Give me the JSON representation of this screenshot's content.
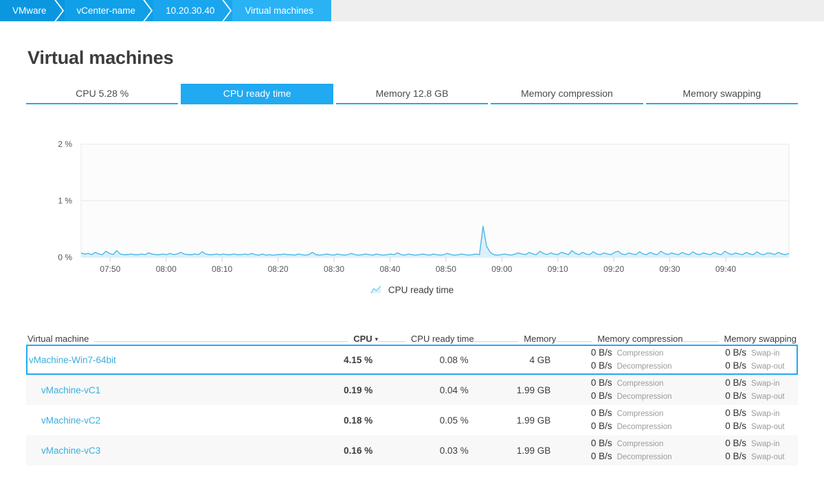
{
  "breadcrumb": {
    "items": [
      {
        "label": "VMware",
        "color": "#0a97e0"
      },
      {
        "label": "vCenter-name",
        "color": "#0fa0e8"
      },
      {
        "label": "10.20.30.40",
        "color": "#19a6ee"
      },
      {
        "label": "Virtual machines",
        "color": "#29b3f5"
      }
    ]
  },
  "header": {
    "title": "Virtual machines"
  },
  "tabs": [
    {
      "label": "CPU 5.28 %",
      "active": false
    },
    {
      "label": "CPU ready time",
      "active": true
    },
    {
      "label": "Memory 12.8 GB",
      "active": false
    },
    {
      "label": "Memory compression",
      "active": false
    },
    {
      "label": "Memory swapping",
      "active": false
    }
  ],
  "chart_legend": {
    "label": "CPU ready time",
    "icon": "line-chart-icon",
    "color": "#38b6ea"
  },
  "chart_data": {
    "type": "area",
    "title": "",
    "xlabel": "",
    "ylabel": "",
    "ylim": [
      0,
      2
    ],
    "ytick_labels": [
      "0 %",
      "1 %",
      "2 %"
    ],
    "ytick_values": [
      0,
      1,
      2
    ],
    "xtick_labels": [
      "07:50",
      "08:00",
      "08:10",
      "08:20",
      "08:30",
      "08:40",
      "08:50",
      "09:00",
      "09:10",
      "09:20",
      "09:30",
      "09:40"
    ],
    "grid": true,
    "legend_position": "bottom-center",
    "line_color": "#4cb8e8",
    "fill_color": "#dcf0fb",
    "series": [
      {
        "name": "CPU ready time",
        "values": [
          0.08,
          0.06,
          0.07,
          0.05,
          0.09,
          0.06,
          0.05,
          0.11,
          0.07,
          0.05,
          0.12,
          0.06,
          0.05,
          0.05,
          0.06,
          0.05,
          0.05,
          0.06,
          0.05,
          0.08,
          0.06,
          0.05,
          0.05,
          0.06,
          0.05,
          0.07,
          0.05,
          0.06,
          0.09,
          0.06,
          0.05,
          0.05,
          0.06,
          0.05,
          0.1,
          0.06,
          0.05,
          0.05,
          0.06,
          0.05,
          0.06,
          0.05,
          0.05,
          0.06,
          0.05,
          0.05,
          0.06,
          0.05,
          0.07,
          0.05,
          0.04,
          0.06,
          0.04,
          0.05,
          0.04,
          0.05,
          0.05,
          0.06,
          0.05,
          0.05,
          0.04,
          0.06,
          0.05,
          0.04,
          0.05,
          0.09,
          0.05,
          0.04,
          0.05,
          0.06,
          0.05,
          0.04,
          0.06,
          0.05,
          0.04,
          0.05,
          0.07,
          0.05,
          0.04,
          0.05,
          0.06,
          0.05,
          0.04,
          0.06,
          0.05,
          0.04,
          0.05,
          0.06,
          0.05,
          0.08,
          0.05,
          0.04,
          0.06,
          0.05,
          0.04,
          0.05,
          0.06,
          0.05,
          0.04,
          0.06,
          0.05,
          0.04,
          0.05,
          0.07,
          0.05,
          0.04,
          0.05,
          0.06,
          0.05,
          0.04,
          0.05,
          0.06,
          0.05,
          0.55,
          0.2,
          0.09,
          0.05,
          0.04,
          0.05,
          0.06,
          0.05,
          0.04,
          0.06,
          0.08,
          0.06,
          0.05,
          0.09,
          0.06,
          0.05,
          0.11,
          0.07,
          0.05,
          0.08,
          0.06,
          0.05,
          0.09,
          0.07,
          0.05,
          0.12,
          0.07,
          0.05,
          0.09,
          0.06,
          0.05,
          0.1,
          0.06,
          0.05,
          0.08,
          0.06,
          0.05,
          0.09,
          0.11,
          0.06,
          0.05,
          0.08,
          0.06,
          0.05,
          0.1,
          0.06,
          0.05,
          0.09,
          0.06,
          0.05,
          0.11,
          0.07,
          0.05,
          0.08,
          0.06,
          0.05,
          0.09,
          0.06,
          0.05,
          0.1,
          0.06,
          0.05,
          0.08,
          0.06,
          0.05,
          0.09,
          0.06,
          0.05,
          0.11,
          0.07,
          0.05,
          0.08,
          0.06,
          0.05,
          0.09,
          0.06,
          0.05,
          0.1,
          0.06,
          0.05,
          0.08,
          0.07,
          0.05,
          0.09,
          0.06,
          0.05,
          0.07
        ]
      }
    ]
  },
  "table": {
    "columns": [
      {
        "key": "name",
        "label": "Virtual machine",
        "sorted": false
      },
      {
        "key": "cpu",
        "label": "CPU",
        "sorted": true,
        "caret": "▾"
      },
      {
        "key": "ready",
        "label": "CPU ready time",
        "sorted": false
      },
      {
        "key": "mem",
        "label": "Memory",
        "sorted": false
      },
      {
        "key": "comp",
        "label": "Memory compression",
        "sorted": false
      },
      {
        "key": "swap",
        "label": "Memory swapping",
        "sorted": false
      }
    ],
    "rows": [
      {
        "name": "vMachine-Win7-64bit",
        "cpu": "4.15 %",
        "ready": "0.08 %",
        "mem": "4 GB",
        "comp": [
          {
            "value": "0 B/s",
            "label": "Compression"
          },
          {
            "value": "0 B/s",
            "label": "Decompression"
          }
        ],
        "swap": [
          {
            "value": "0 B/s",
            "label": "Swap-in"
          },
          {
            "value": "0 B/s",
            "label": "Swap-out"
          }
        ],
        "selected": true,
        "zebra": false
      },
      {
        "name": "vMachine-vC1",
        "cpu": "0.19 %",
        "ready": "0.04 %",
        "mem": "1.99 GB",
        "comp": [
          {
            "value": "0 B/s",
            "label": "Compression"
          },
          {
            "value": "0 B/s",
            "label": "Decompression"
          }
        ],
        "swap": [
          {
            "value": "0 B/s",
            "label": "Swap-in"
          },
          {
            "value": "0 B/s",
            "label": "Swap-out"
          }
        ],
        "selected": false,
        "zebra": true
      },
      {
        "name": "vMachine-vC2",
        "cpu": "0.18 %",
        "ready": "0.05 %",
        "mem": "1.99 GB",
        "comp": [
          {
            "value": "0 B/s",
            "label": "Compression"
          },
          {
            "value": "0 B/s",
            "label": "Decompression"
          }
        ],
        "swap": [
          {
            "value": "0 B/s",
            "label": "Swap-in"
          },
          {
            "value": "0 B/s",
            "label": "Swap-out"
          }
        ],
        "selected": false,
        "zebra": false
      },
      {
        "name": "vMachine-vC3",
        "cpu": "0.16 %",
        "ready": "0.03 %",
        "mem": "1.99 GB",
        "comp": [
          {
            "value": "0 B/s",
            "label": "Compression"
          },
          {
            "value": "0 B/s",
            "label": "Decompression"
          }
        ],
        "swap": [
          {
            "value": "0 B/s",
            "label": "Swap-in"
          },
          {
            "value": "0 B/s",
            "label": "Swap-out"
          }
        ],
        "selected": false,
        "zebra": true
      }
    ]
  }
}
